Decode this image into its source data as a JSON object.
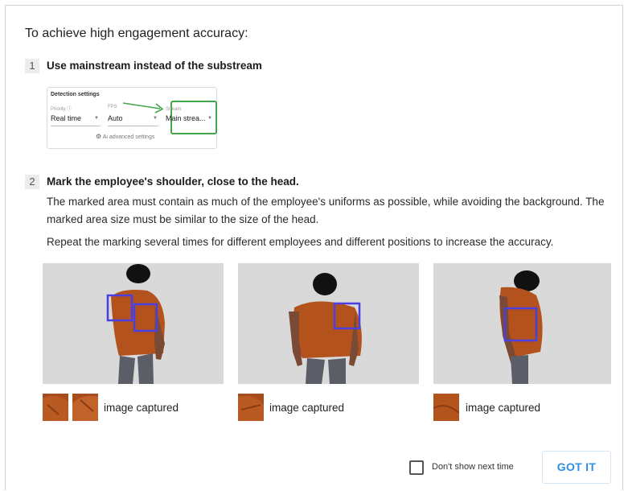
{
  "dialog": {
    "title": "To achieve high engagement accuracy:",
    "step1": {
      "number": "1",
      "heading": "Use mainstream instead of the substream",
      "settings": {
        "title": "Detection settings",
        "priority_label": "Priority ⓘ",
        "priority_value": "Real time",
        "fps_label": "FPS",
        "fps_value": "Auto",
        "stream_label": "Stream",
        "stream_value": "Main strea...",
        "advanced_label": "Ai advanced settings",
        "highlight_color": "#44a64a"
      }
    },
    "step2": {
      "number": "2",
      "heading": "Mark the employee's shoulder, close to the head.",
      "para1": "The marked area must contain as much of the employee's uniforms as possible, while avoiding the background. The marked area size must be similar to the size of the head.",
      "para2": "Repeat the marking several times for different employees and different positions to increase the accuracy.",
      "examples": [
        {
          "caption": "image captured"
        },
        {
          "caption": "image captured"
        },
        {
          "caption": "image captured"
        }
      ],
      "marker_color": "#4a3fe0"
    },
    "footer": {
      "dont_show_label": "Don't show next time",
      "got_it_label": "GOT IT",
      "accent": "#2e8ee6"
    }
  }
}
